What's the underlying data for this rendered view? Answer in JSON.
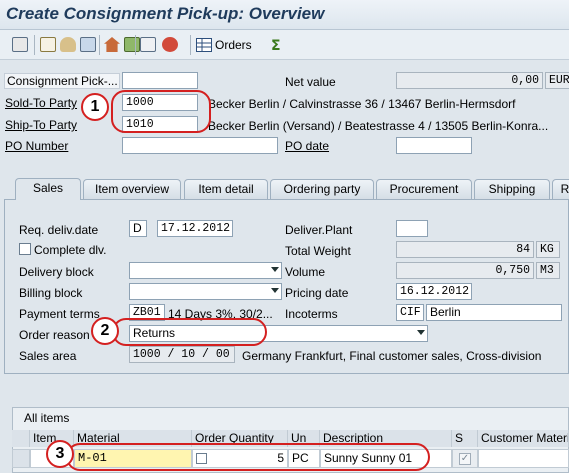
{
  "title": "Create Consignment Pick-up: Overview",
  "toolbar": {
    "orders_label": "Orders"
  },
  "header": {
    "consignment_label": "Consignment Pick-...",
    "net_value_label": "Net value",
    "net_value": "0,00",
    "currency": "EUR",
    "sold_to_label": "Sold-To Party",
    "sold_to_value": "1000",
    "sold_to_text": "Becker Berlin / Calvinstrasse 36 / 13467 Berlin-Hermsdorf",
    "ship_to_label": "Ship-To Party",
    "ship_to_value": "1010",
    "ship_to_text": "Becker Berlin (Versand) / Beatestrasse 4 / 13505 Berlin-Konra...",
    "po_number_label": "PO Number",
    "po_date_label": "PO date"
  },
  "tabs": [
    "Sales",
    "Item overview",
    "Item detail",
    "Ordering party",
    "Procurement",
    "Shipping",
    "R"
  ],
  "sales": {
    "req_deliv_label": "Req. deliv.date",
    "req_deliv_type": "D",
    "req_deliv_date": "17.12.2012",
    "deliver_plant_label": "Deliver.Plant",
    "complete_dlv_label": "Complete dlv.",
    "total_weight_label": "Total Weight",
    "total_weight": "84",
    "weight_unit": "KG",
    "delivery_block_label": "Delivery block",
    "volume_label": "Volume",
    "volume": "0,750",
    "volume_unit": "M3",
    "billing_block_label": "Billing block",
    "pricing_date_label": "Pricing date",
    "pricing_date": "16.12.2012",
    "payment_terms_label": "Payment terms",
    "payment_terms_code": "ZB01",
    "payment_terms_text": "14 Days 3%, 30/2...",
    "incoterms_label": "Incoterms",
    "incoterms_code": "CIF",
    "incoterms_place": "Berlin",
    "order_reason_label": "Order reason",
    "order_reason_value": "Returns",
    "sales_area_label": "Sales area",
    "sales_area_value": "1000 / 10 / 00",
    "sales_area_text": "Germany Frankfurt, Final customer sales, Cross-division"
  },
  "items": {
    "section_label": "All items",
    "headers": [
      "Item",
      "Material",
      "Order Quantity",
      "Un",
      "Description",
      "S",
      "Customer Material"
    ],
    "row": {
      "material": "M-01",
      "quantity": "5",
      "unit": "PC",
      "description": "Sunny Sunny 01"
    }
  },
  "callouts": [
    "1",
    "2",
    "3"
  ],
  "colors": {
    "callout": "#d42020",
    "title": "#1f3b5c",
    "highlight": "#fff5b0"
  }
}
